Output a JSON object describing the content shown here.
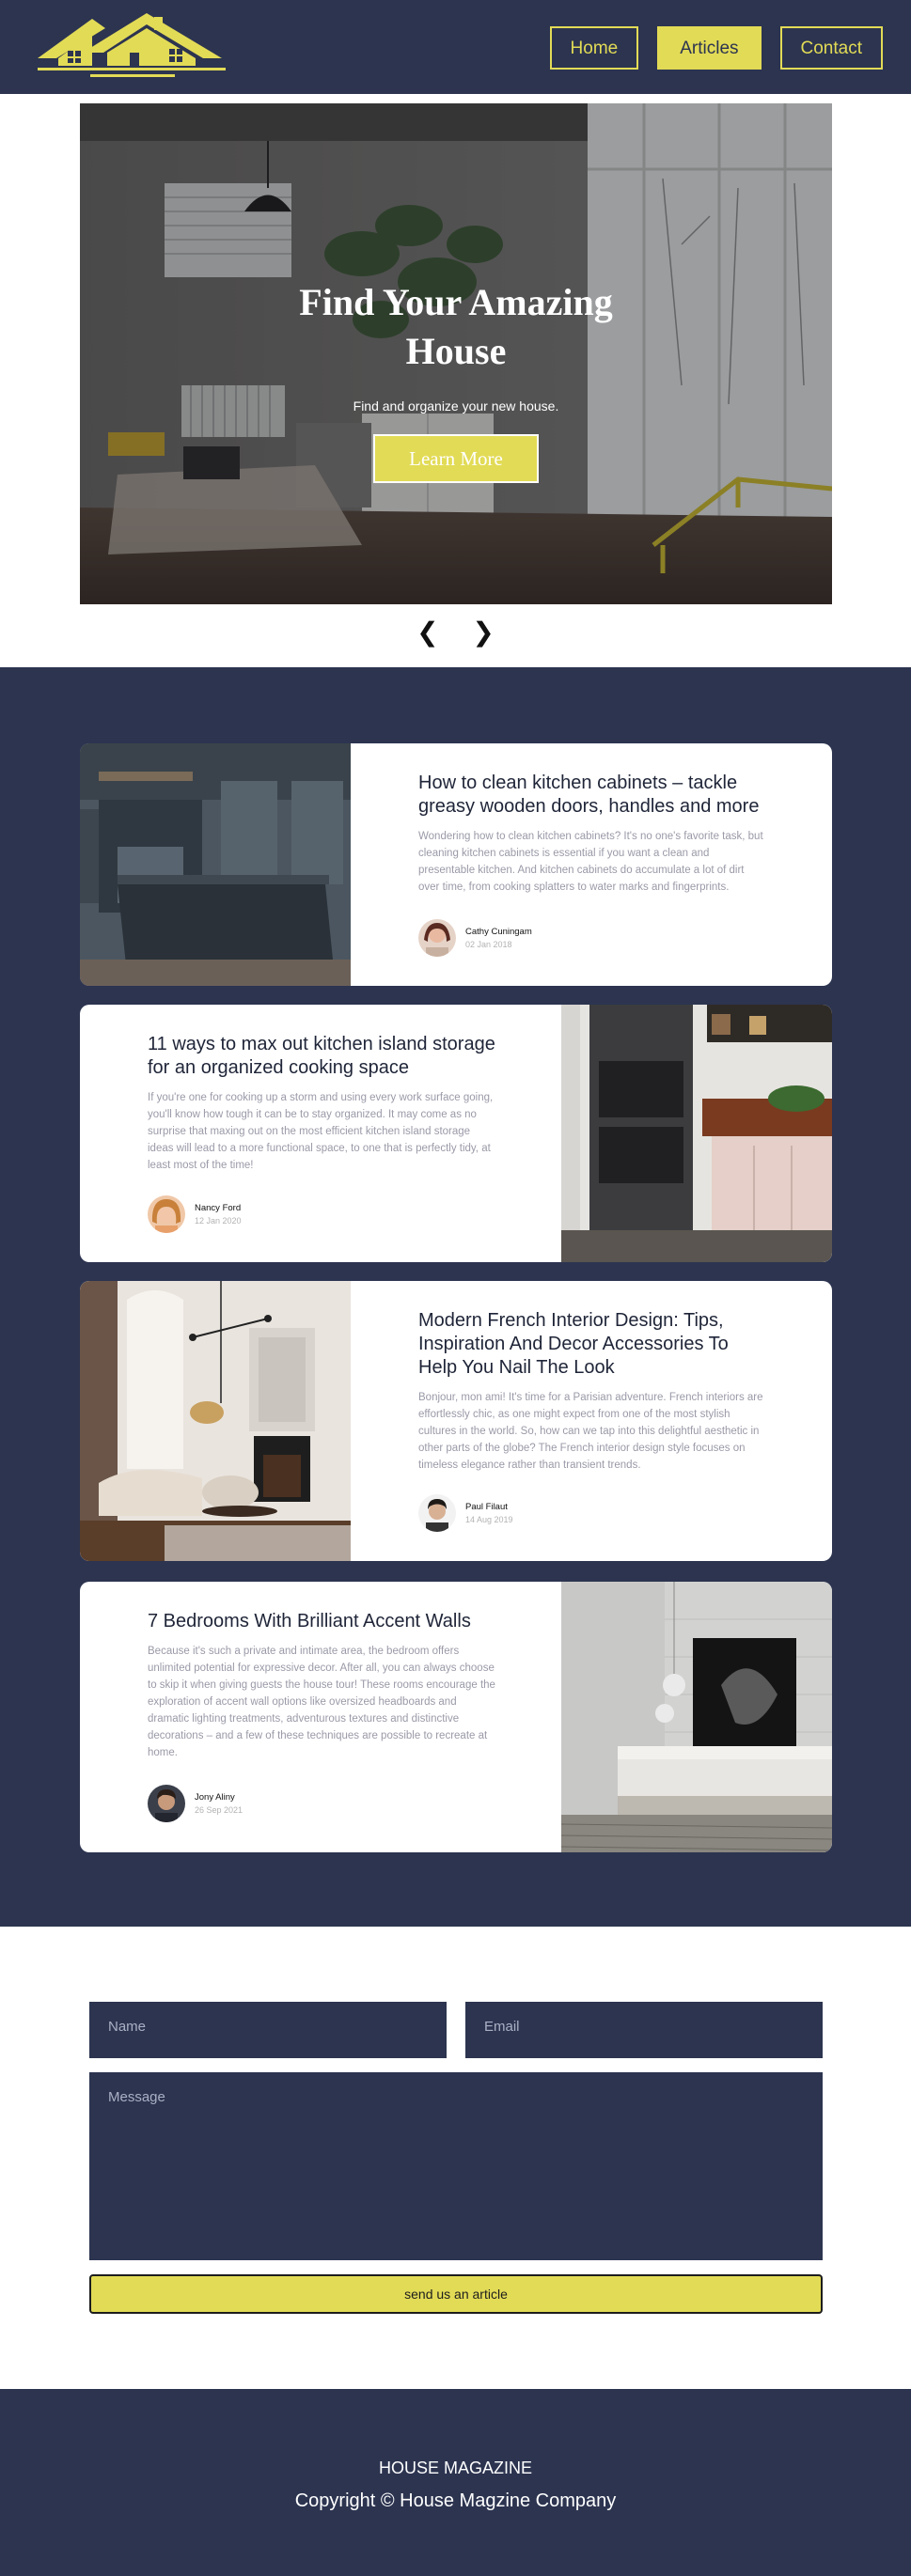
{
  "colors": {
    "navy": "#2c3450",
    "accent": "#e2db56",
    "white": "#ffffff"
  },
  "header": {
    "logo_icon": "house-logo-icon",
    "nav": [
      {
        "label": "Home"
      },
      {
        "label": "Articles",
        "active": true
      },
      {
        "label": "Contact"
      }
    ]
  },
  "hero": {
    "title": "Find Your Amazing House",
    "subtitle": "Find and organize your new house.",
    "cta": "Learn More",
    "prev_arrow": "❮",
    "next_arrow": "❯"
  },
  "articles": [
    {
      "title": "How to clean kitchen cabinets – tackle greasy wooden doors, handles and more",
      "excerpt": "Wondering how to clean kitchen cabinets? It's no one's favorite task, but cleaning kitchen cabinets is essential if you want a clean and presentable kitchen. And kitchen cabinets do accumulate a lot of dirt over time, from cooking splatters to water marks and fingerprints.",
      "author": "Cathy Cuningam",
      "date": "02 Jan 2018"
    },
    {
      "title": "11 ways to max out kitchen island storage for an organized cooking space",
      "excerpt": "If you're one for cooking up a storm and using every work surface going, you'll know how tough it can be to stay organized. It may come as no surprise that maxing out on the most efficient kitchen island storage ideas will lead to a more functional space, to one that is perfectly tidy, at least most of the time!",
      "author": "Nancy Ford",
      "date": "12 Jan 2020"
    },
    {
      "title": "Modern French Interior Design: Tips, Inspiration And Decor Accessories To Help You Nail The Look",
      "excerpt": "Bonjour, mon ami! It's time for a Parisian adventure. French interiors are effortlessly chic, as one might expect from one of the most stylish cultures in the world. So, how can we tap into this delightful aesthetic in other parts of the globe? The French interior design style focuses on timeless elegance rather than transient trends.",
      "author": "Paul Filaut",
      "date": "14 Aug 2019"
    },
    {
      "title": "7 Bedrooms With Brilliant Accent Walls",
      "excerpt": "Because it's such a private and intimate area, the bedroom offers unlimited potential for expressive decor. After all, you can always choose to skip it when giving guests the house tour! These rooms encourage the exploration of accent wall options like oversized headboards and dramatic lighting treatments, adventurous textures and distinctive decorations – and a few of these techniques are possible to recreate at home.",
      "author": "Jony Aliny",
      "date": "26 Sep 2021"
    }
  ],
  "contact": {
    "name_placeholder": "Name",
    "email_placeholder": "Email",
    "message_placeholder": "Message",
    "submit": "send us an article"
  },
  "footer": {
    "brand": "HOUSE MAGAZINE",
    "copyright": "Copyright © House Magzine Company"
  }
}
